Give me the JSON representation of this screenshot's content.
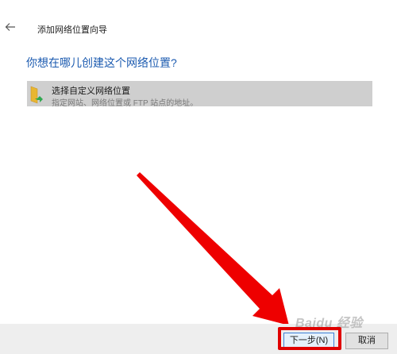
{
  "window": {
    "title": "添加网络位置向导",
    "back_icon": "back-arrow-icon"
  },
  "main": {
    "heading": "你想在哪儿创建这个网络位置?",
    "options": [
      {
        "icon": "folder-icon",
        "title": "选择自定义网络位置",
        "description": "指定网站、网络位置或 FTP 站点的地址。"
      }
    ]
  },
  "buttons": {
    "next": "下一步(N)",
    "cancel": "取消"
  },
  "annotation": {
    "arrow_color": "#e00000",
    "highlight_color": "#e00000"
  },
  "watermark": "Baidu 经验"
}
